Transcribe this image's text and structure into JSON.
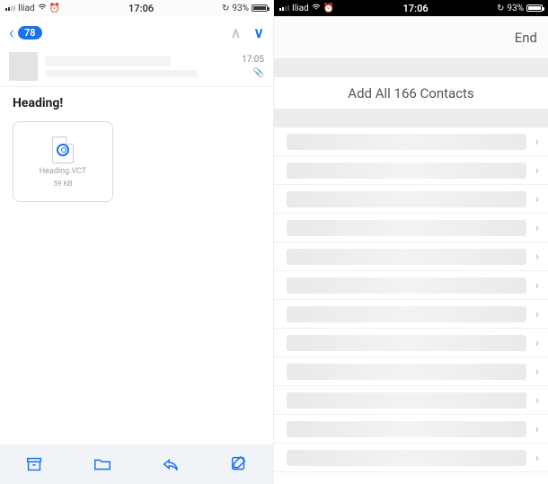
{
  "left": {
    "status": {
      "carrier": "Iliad",
      "time": "17:06",
      "battery_pct": "93%"
    },
    "nav": {
      "count": "78"
    },
    "message": {
      "time": "17:05"
    },
    "heading": "Heading!",
    "attachment": {
      "filename": "Heading.VCT",
      "filesize": "59 KB"
    }
  },
  "right": {
    "status": {
      "carrier": "Iliad",
      "time": "17:06",
      "battery_pct": "93%"
    },
    "nav": {
      "end": "End"
    },
    "add_all": "Add All 166 Contacts",
    "rows": [
      "",
      "",
      "",
      "",
      "",
      "",
      "",
      "",
      "",
      "",
      "",
      ""
    ]
  }
}
